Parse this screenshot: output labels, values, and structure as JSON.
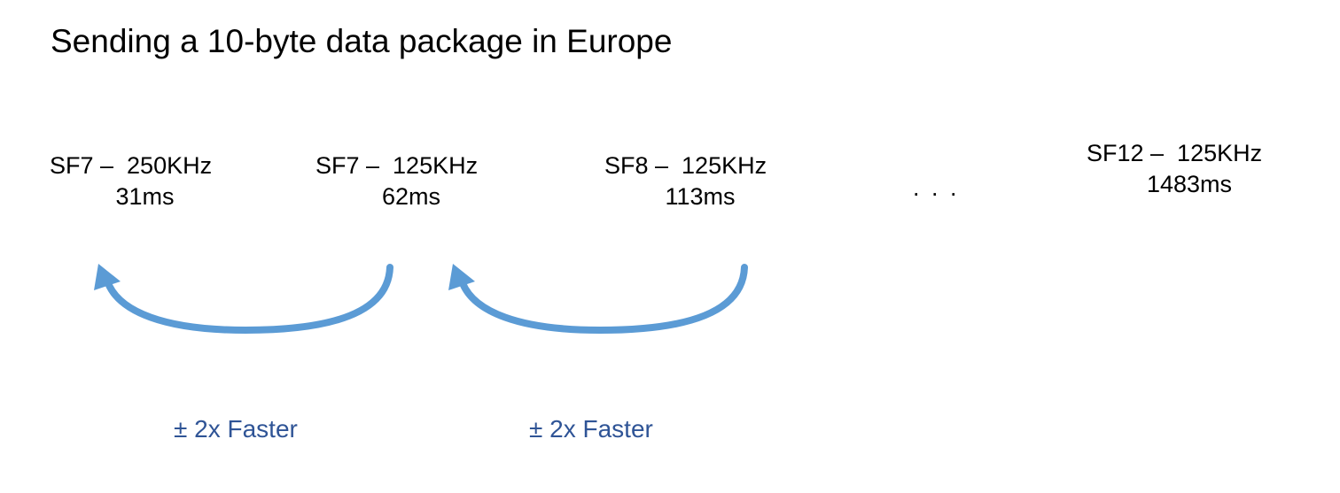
{
  "title": "Sending a 10-byte data package in Europe",
  "nodes": [
    {
      "label": "SF7 –  250KHz",
      "time": "31ms"
    },
    {
      "label": "SF7 –  125KHz",
      "time": "62ms"
    },
    {
      "label": "SF8 –  125KHz",
      "time": "113ms"
    },
    {
      "label": "SF12 –  125KHz",
      "time": "1483ms"
    }
  ],
  "ellipsis": ". . .",
  "transitions": [
    {
      "label": "± 2x Faster"
    },
    {
      "label": "± 2x Faster"
    }
  ],
  "colors": {
    "arrow": "#5b9bd5",
    "transition_text": "#2f5496",
    "text": "#000000"
  }
}
